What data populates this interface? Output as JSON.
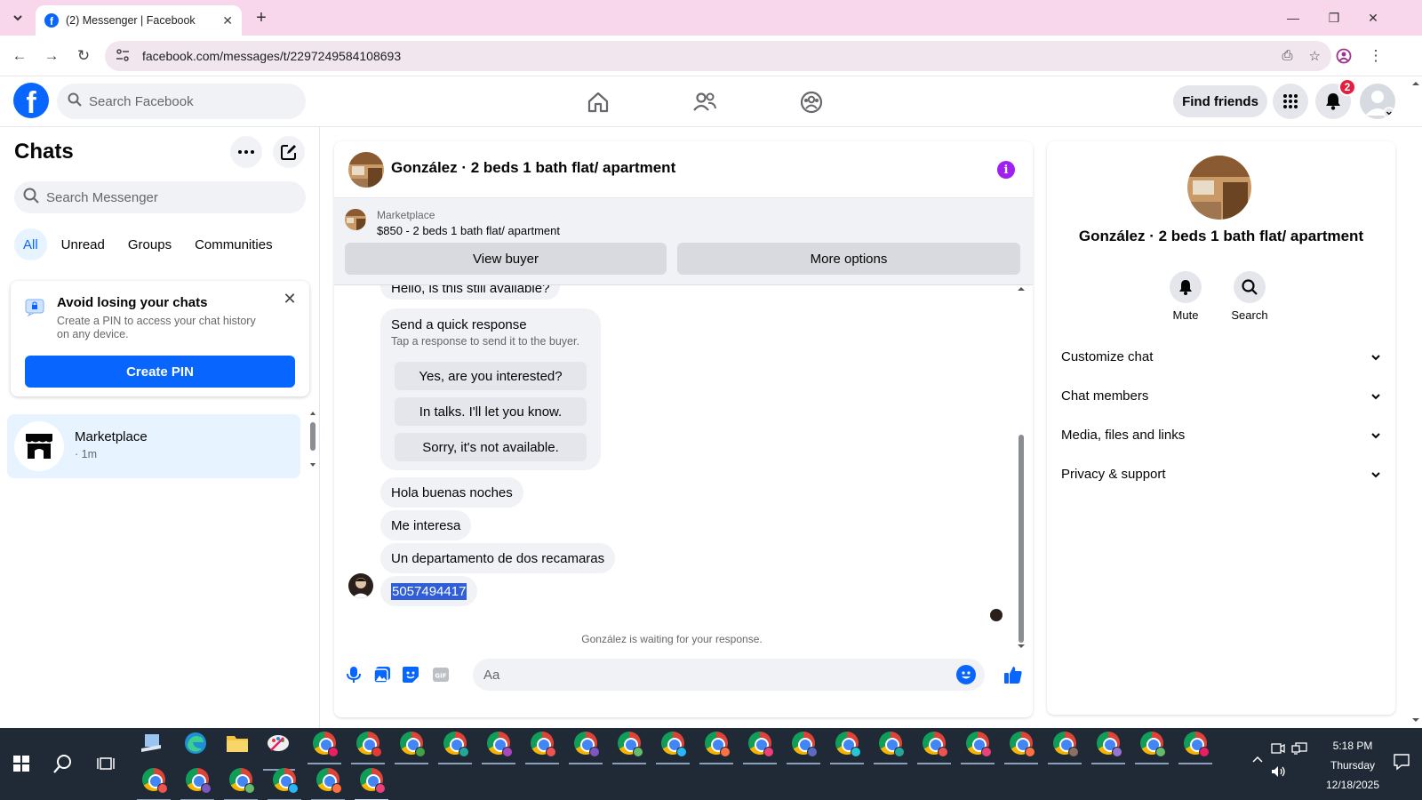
{
  "browser": {
    "tab_title": "(2) Messenger | Facebook",
    "url": "facebook.com/messages/t/2297249584108693"
  },
  "fb": {
    "search_placeholder": "Search Facebook",
    "find_friends": "Find friends",
    "notification_count": "2"
  },
  "sidebar": {
    "title": "Chats",
    "search_placeholder": "Search Messenger",
    "filters": [
      "All",
      "Unread",
      "Groups",
      "Communities"
    ],
    "pin_card": {
      "title": "Avoid losing your chats",
      "subtitle": "Create a PIN to access your chat history on any device.",
      "button": "Create PIN"
    },
    "chats": [
      {
        "name": "Marketplace",
        "meta": "· 1m"
      }
    ]
  },
  "conversation": {
    "title": "González · 2 beds 1 bath flat/ apartment",
    "marketplace": {
      "label": "Marketplace",
      "listing": "$850 - 2 beds 1 bath flat/ apartment",
      "view_buyer": "View buyer",
      "more_options": "More options"
    },
    "partial_message": "Hello, is this still available?",
    "quick_response": {
      "title": "Send a quick response",
      "subtitle": "Tap a response to send it to the buyer.",
      "options": [
        "Yes, are you interested?",
        "In talks. I'll let you know.",
        "Sorry, it's not available."
      ]
    },
    "messages": [
      "Hola buenas noches",
      "Me interesa",
      "Un departamento de dos recamaras",
      "5057494417"
    ],
    "waiting_text": "González is waiting for your response.",
    "composer_placeholder": "Aa"
  },
  "right_panel": {
    "title": "González · 2 beds 1 bath flat/ apartment",
    "actions": [
      "Mute",
      "Search"
    ],
    "sections": [
      "Customize chat",
      "Chat members",
      "Media, files and links",
      "Privacy & support"
    ]
  },
  "taskbar": {
    "time": "5:18 PM",
    "day": "Thursday",
    "date": "12/18/2025"
  },
  "colors": {
    "fb_blue": "#0866ff",
    "info_purple": "#a020f0",
    "selection": "#2f5ed6"
  }
}
